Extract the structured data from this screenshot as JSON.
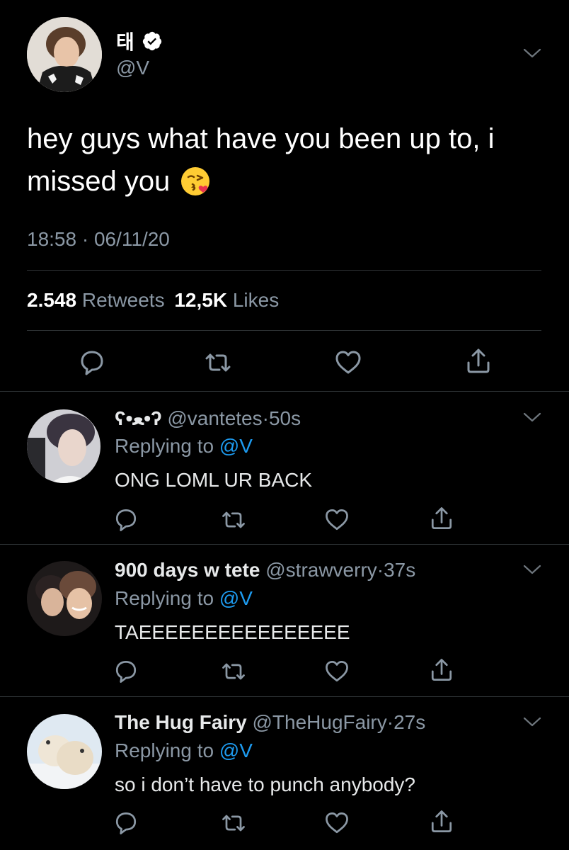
{
  "tweet": {
    "author_name": "태",
    "handle": "@V",
    "text_line1": "hey guys what have you been up to, i",
    "text_line2": "missed you",
    "emoji": "😘",
    "time": "18:58",
    "date_sep": "·",
    "date": "06/11/20",
    "retweets_count": "2.548",
    "retweets_label": "Retweets",
    "likes_count": "12,5K",
    "likes_label": "Likes"
  },
  "replies": [
    {
      "name": "ʕ•ﻌ•ʔ",
      "handle": "@vantetes",
      "sep": "·",
      "time": "50s",
      "replying_label": "Replying to",
      "replying_to": "@V",
      "text": "ONG LOML UR BACK"
    },
    {
      "name": "900 days w tete",
      "handle": "@strawverry",
      "sep": "·",
      "time": "37s",
      "replying_label": "Replying to",
      "replying_to": "@V",
      "text": "TAEEEEEEEEEEEEEEEE"
    },
    {
      "name": "The Hug Fairy",
      "handle": "@TheHugFairy",
      "sep": "·",
      "time": "27s",
      "replying_label": "Replying to",
      "replying_to": "@V",
      "text": "so i don’t have to punch anybody?"
    }
  ],
  "icons": {
    "verified": "verified-badge-icon",
    "reply": "reply-icon",
    "retweet": "retweet-icon",
    "like": "heart-icon",
    "share": "share-icon",
    "more": "chevron-down-icon"
  },
  "colors": {
    "background": "#000000",
    "text": "#e7e9ea",
    "muted": "#8b98a5",
    "link": "#1d9bf0",
    "divider": "#2f3336"
  }
}
